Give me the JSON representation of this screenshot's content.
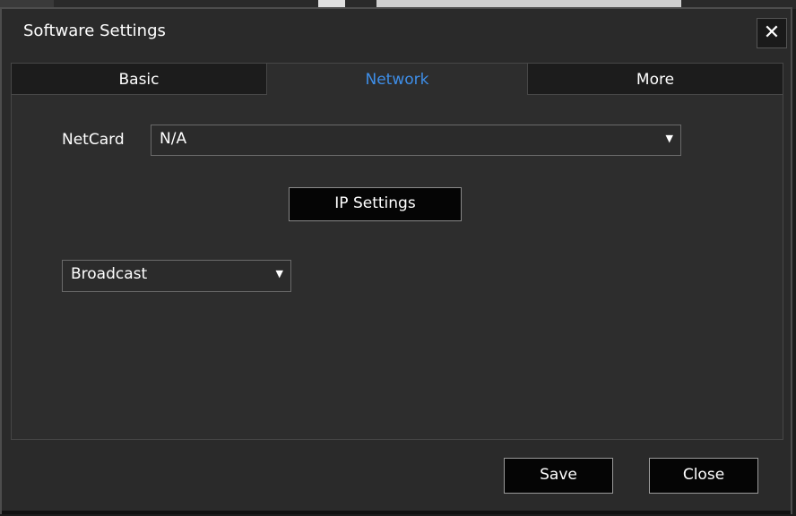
{
  "dialog": {
    "title": "Software Settings",
    "close_glyph": "✕"
  },
  "tabs": [
    {
      "label": "Basic",
      "active": false
    },
    {
      "label": "Network",
      "active": true
    },
    {
      "label": "More",
      "active": false
    }
  ],
  "network": {
    "netcard_label": "NetCard",
    "netcard_value": "N/A",
    "ip_settings_label": "IP Settings",
    "mode_value": "Broadcast",
    "dropdown_arrow": "▼"
  },
  "footer": {
    "save_label": "Save",
    "close_label": "Close"
  },
  "colors": {
    "accent": "#3e8ee8",
    "background": "#2a2a2a"
  }
}
